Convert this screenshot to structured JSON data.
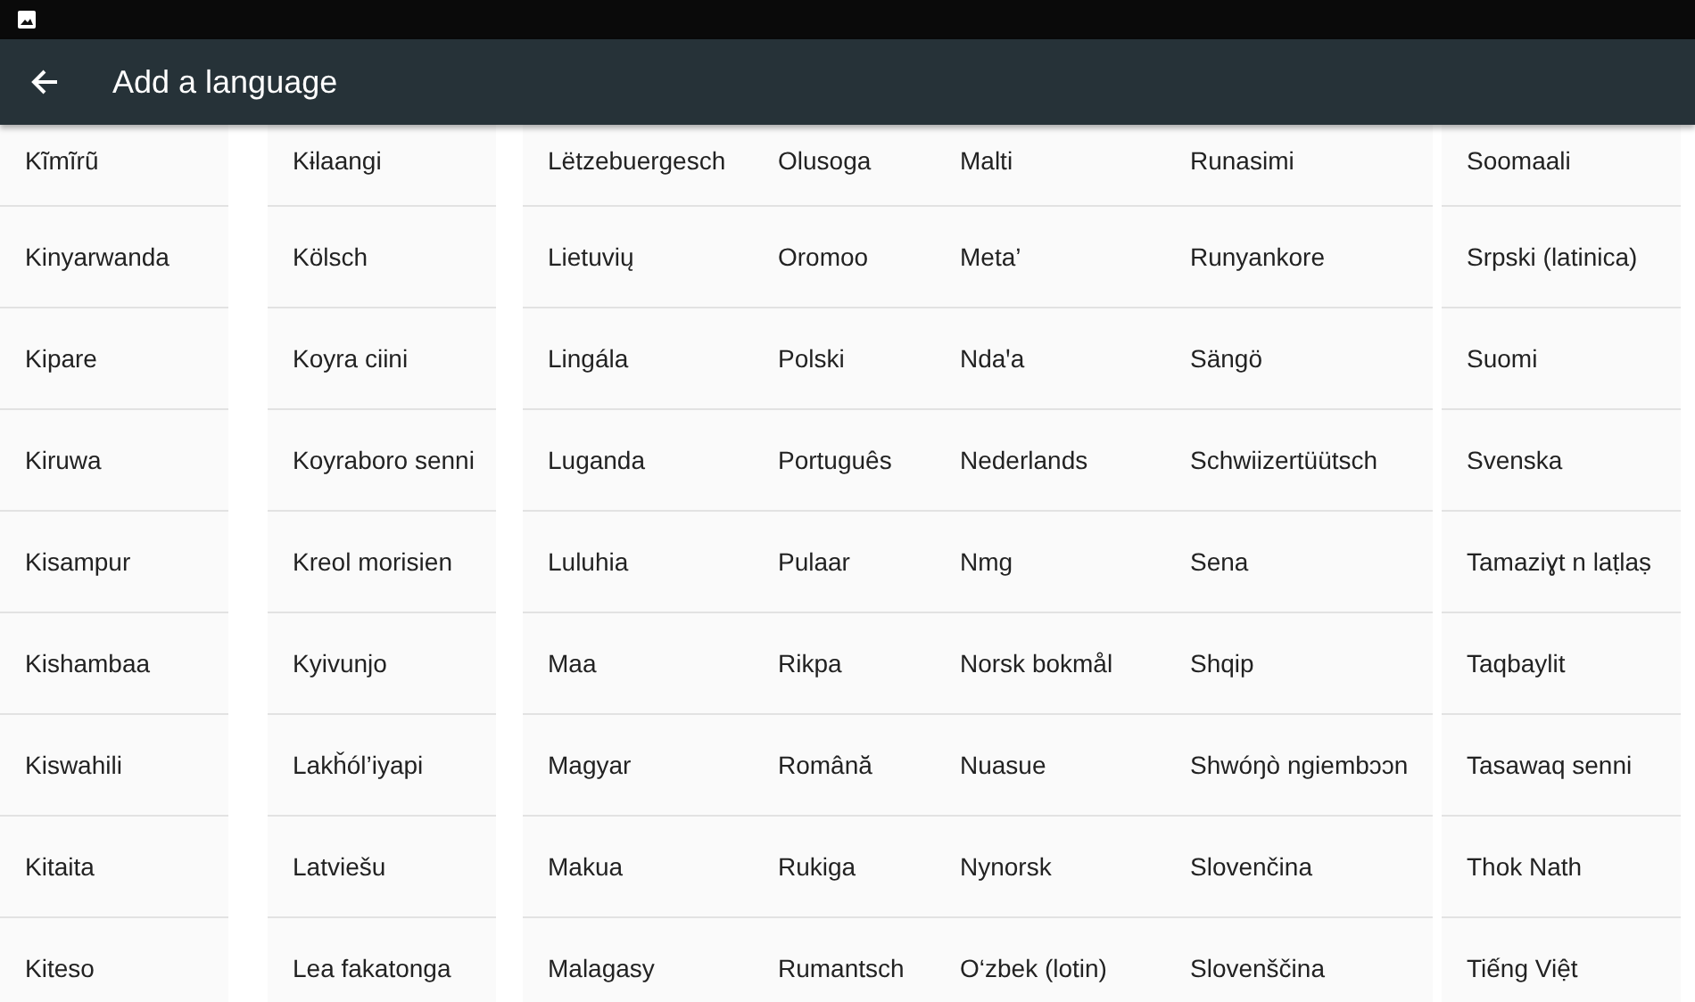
{
  "app_bar": {
    "title": "Add a language"
  },
  "columns": [
    [
      "Kĩmĩrũ",
      "Kinyarwanda",
      "Kipare",
      "Kiruwa",
      "Kisampur",
      "Kishambaa",
      "Kiswahili",
      "Kitaita",
      "Kiteso"
    ],
    [
      "Kɨlaangi",
      "Kölsch",
      "Koyra ciini",
      "Koyraboro senni",
      "Kreol morisien",
      "Kyivunjo",
      "Lakȟól’iyapi",
      "Latviešu",
      "Lea fakatonga"
    ],
    [
      "Lëtzebuergesch",
      "Lietuvių",
      "Lingála",
      "Luganda",
      "Luluhia",
      "Maa",
      "Magyar",
      "Makua",
      "Malagasy"
    ],
    [
      "Olusoga",
      "Oromoo",
      "Polski",
      "Português",
      "Pulaar",
      "Rikpa",
      "Română",
      "Rukiga",
      "Rumantsch"
    ],
    [
      "Malti",
      "Meta’",
      "Ndaꞌa",
      "Nederlands",
      "Nmg",
      "Norsk bokmål",
      "Nuasue",
      "Nynorsk",
      "O‘zbek (lotin)"
    ],
    [
      "Runasimi",
      "Runyankore",
      "Sängö",
      "Schwiizertüütsch",
      "Sena",
      "Shqip",
      "Shwóŋò ngiembɔɔn",
      "Slovenčina",
      "Slovenščina"
    ],
    [
      "Soomaali",
      "Srpski (latinica)",
      "Suomi",
      "Svenska",
      "Tamaziɣt n laṭlaṣ",
      "Taqbaylit",
      "Tasawaq senni",
      "Thok Nath",
      "Tiếng Việt"
    ]
  ]
}
